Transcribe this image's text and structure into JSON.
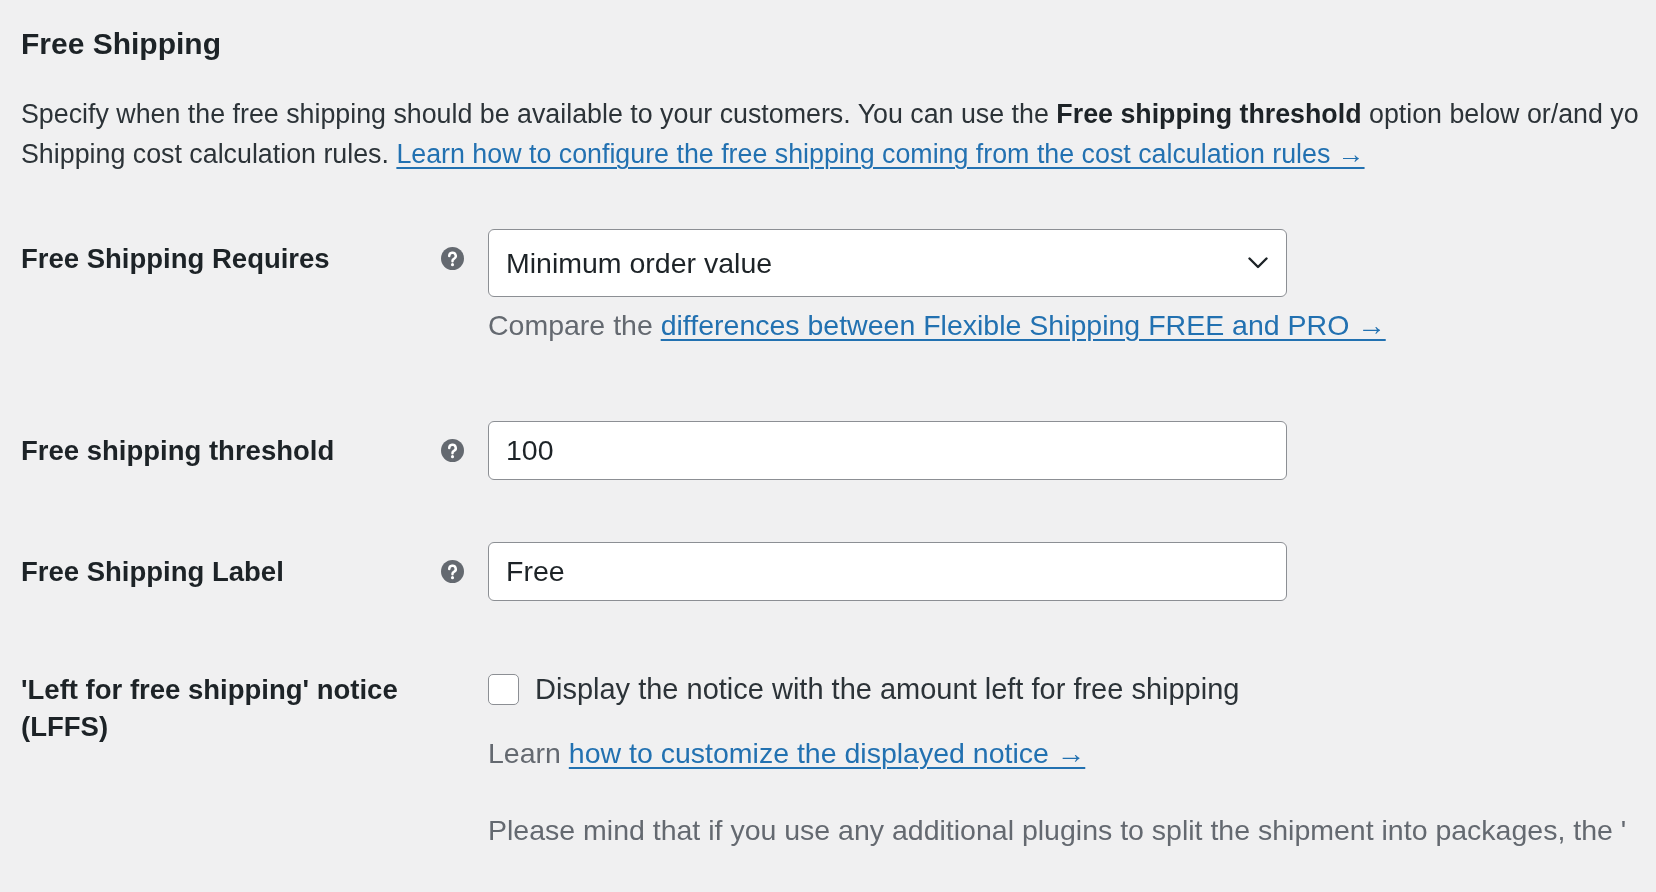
{
  "section_title": "Free Shipping",
  "description": {
    "lines": [
      "Specify when the free shipping should be available to your customers. You can use the **Free shipping threshold** option below or/and yo",
      "Shipping cost calculation rules."
    ],
    "link": "Learn how to configure the free shipping coming from the cost calculation rules →"
  },
  "fields": [
    {
      "kind": "select",
      "label": "Free Shipping Requires",
      "help": true,
      "value": "Minimum order value",
      "notes": [
        {
          "text": "Compare the",
          "link": "differences between Flexible Shipping FREE and PRO →"
        }
      ]
    },
    {
      "kind": "text",
      "label": "Free shipping threshold",
      "help": true,
      "value": "100"
    },
    {
      "kind": "text",
      "label": "Free Shipping Label",
      "help": true,
      "value": "Free"
    },
    {
      "kind": "checkbox",
      "label": "'Left for free shipping' notice (LFFS)",
      "help": false,
      "checked": false,
      "checkbox_label": "Display the notice with the amount left for free shipping",
      "notes": [
        {
          "text": "Learn",
          "link": "how to customize the displayed notice →"
        },
        {
          "text": "Please mind that if you use any additional plugins to split the shipment into packages, the '"
        }
      ]
    }
  ]
}
